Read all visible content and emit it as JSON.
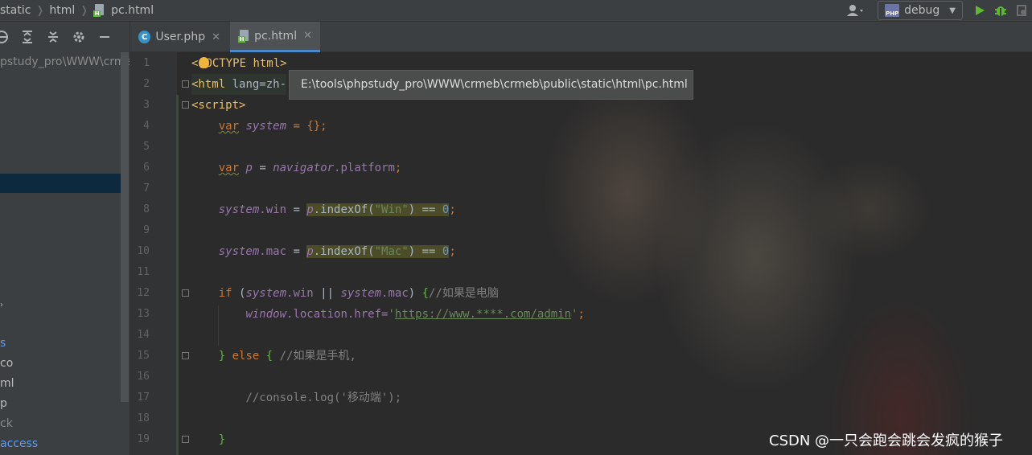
{
  "navbar": {
    "breadcrumbs": [
      "static",
      "html",
      "pc.html"
    ],
    "run_config": "debug",
    "colors": {
      "run": "#5fb832",
      "debug": "#5fb832"
    }
  },
  "project": {
    "root_path": "pstudy_pro\\WWW\\crme",
    "items": [
      "s",
      "co",
      "ml",
      "p",
      "ck",
      "access"
    ]
  },
  "tabs": [
    {
      "label": "User.php",
      "active": false
    },
    {
      "label": "pc.html",
      "active": true
    }
  ],
  "tooltip": "E:\\tools\\phpstudy_pro\\WWW\\crmeb\\crmeb\\public\\static\\html\\pc.html",
  "code": {
    "line_numbers": [
      "1",
      "2",
      "3",
      "4",
      "5",
      "6",
      "7",
      "8",
      "9",
      "10",
      "11",
      "12",
      "13",
      "14",
      "15",
      "16",
      "17",
      "18",
      "19"
    ],
    "l1_open": "<",
    "l1_rest": "OCTYPE html",
    "l1_close": ">",
    "l2_tag": "<html",
    "l2_attr": " lang=zh-",
    "l3": "<script>",
    "var_kw": "var",
    "system": "system",
    "l4_rest": " = {};",
    "p": "p",
    "navigator": "navigator",
    "platform": ".platform",
    "win": ".win",
    "mac": ".mac",
    "index_of": ".indexOf(",
    "str_win": "\"Win\"",
    "str_mac": "\"Mac\"",
    "eq_zero": ") == ",
    "zero": "0",
    "if_kw": "if",
    "or": " || ",
    "comment_pc": "//如果是电脑",
    "window": "window",
    "href": ".location.href=",
    "url": "https://www.****.com/admin",
    "else_kw": "else",
    "comment_mobile": "//如果是手机,",
    "console_comment": "//console.log('移动端');",
    "close_brace": "}"
  },
  "watermark": "CSDN @一只会跑会跳会发疯的猴子"
}
